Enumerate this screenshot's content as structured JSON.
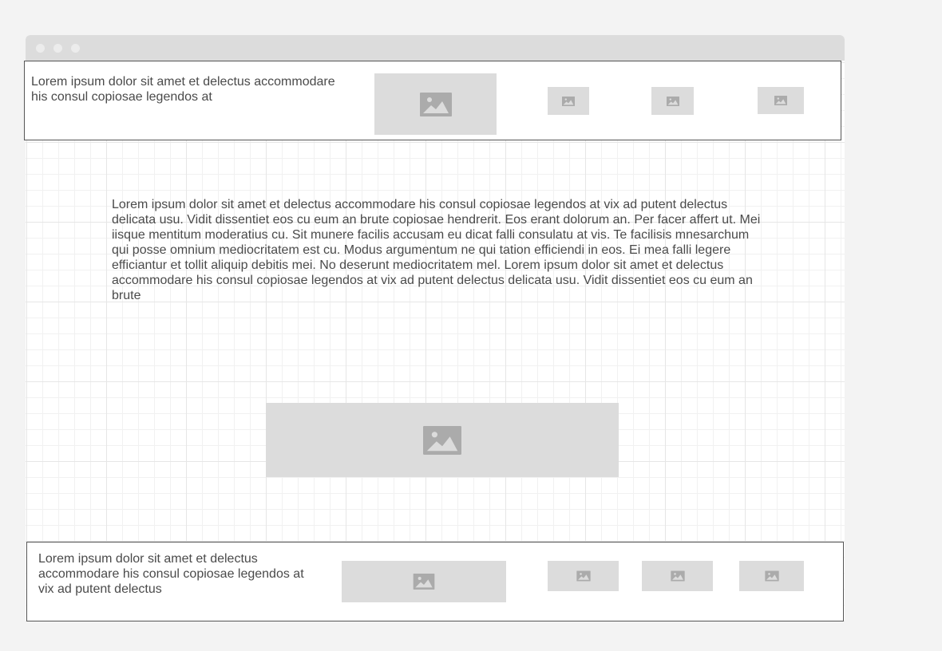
{
  "header": {
    "text": "Lorem ipsum dolor sit amet et delectus accommodare his consul copiosae legendos at"
  },
  "main": {
    "paragraph": "Lorem ipsum dolor sit amet et delectus accommodare his consul copiosae legendos at vix ad putent delectus delicata usu. Vidit dissentiet eos cu eum an brute copiosae hendrerit. Eos erant dolorum an. Per facer affert ut. Mei iisque mentitum moderatius cu. Sit munere facilis accusam eu dicat falli consulatu at vis. Te facilisis mnesarchum qui posse omnium mediocritatem est cu. Modus argumentum ne qui tation efficiendi in eos. Ei mea falli legere efficiantur et tollit aliquip debitis mei. No deserunt mediocritatem mel. Lorem ipsum dolor sit amet et delectus accommodare his consul copiosae legendos at vix ad putent delectus delicata usu. Vidit dissentiet eos cu eum an brute"
  },
  "footer": {
    "text": "Lorem ipsum dolor sit amet et delectus accommodare his consul copiosae legendos at vix ad putent delectus"
  },
  "colors": {
    "placeholder": "#dcdcdc",
    "icon": "#ababab",
    "titlebar": "#dcdcdc",
    "border": "#555555"
  },
  "icons": {
    "placeholder_image": "image-icon",
    "window_control": "window-dot"
  }
}
